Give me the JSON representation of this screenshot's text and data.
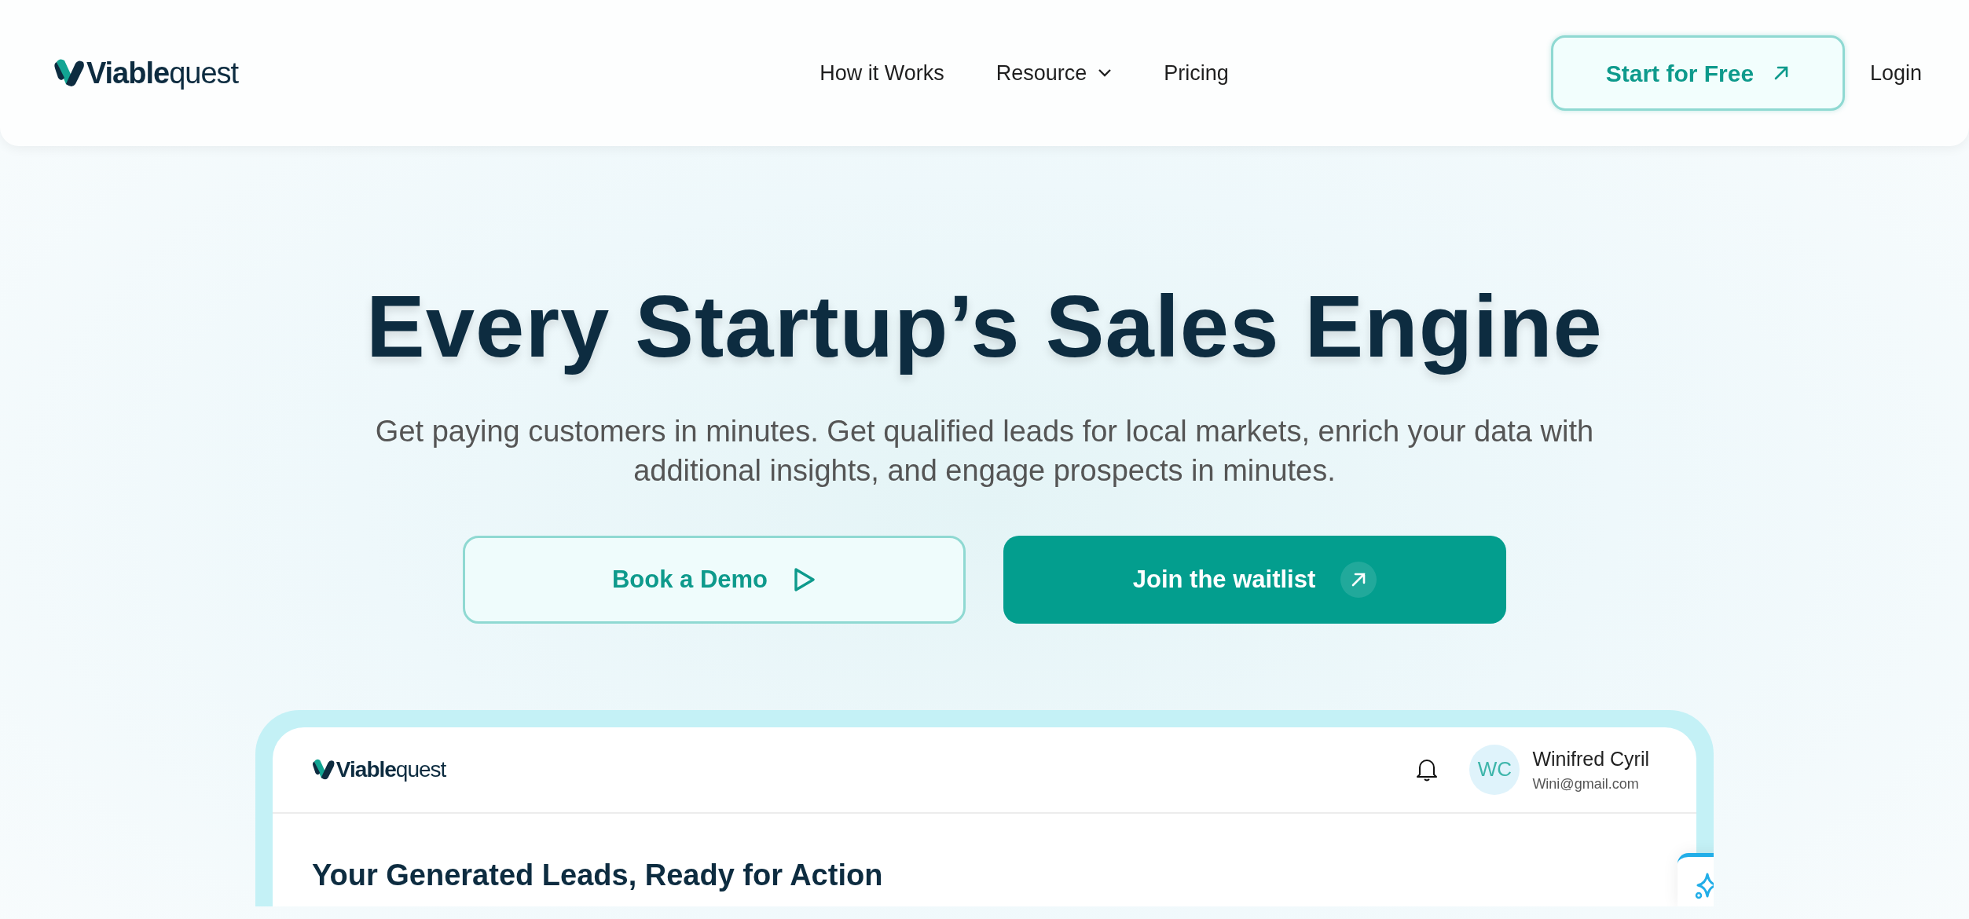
{
  "brand": {
    "name_bold": "Viable",
    "name_light": "quest"
  },
  "nav": [
    {
      "label": "How it Works",
      "kind": "link"
    },
    {
      "label": "Resource",
      "kind": "dropdown"
    },
    {
      "label": "Pricing",
      "kind": "link"
    }
  ],
  "header_actions": {
    "primary": "Start for Free",
    "secondary": "Login"
  },
  "hero": {
    "title": "Every Startup’s Sales Engine",
    "subtitle": "Get paying customers in minutes. Get qualified leads for local markets, enrich your data with additional insights, and engage prospects in minutes.",
    "buttons": [
      {
        "label": "Book a Demo",
        "kind": "outline"
      },
      {
        "label": "Join the waitlist",
        "kind": "solid"
      }
    ]
  },
  "preview": {
    "brand": {
      "name_bold": "Viable",
      "name_light": "quest"
    },
    "user": {
      "initials": "WC",
      "name": "Winifred Cyril",
      "email": "Wini@gmail.com"
    },
    "heading": "Your Generated Leads, Ready for Action"
  }
}
